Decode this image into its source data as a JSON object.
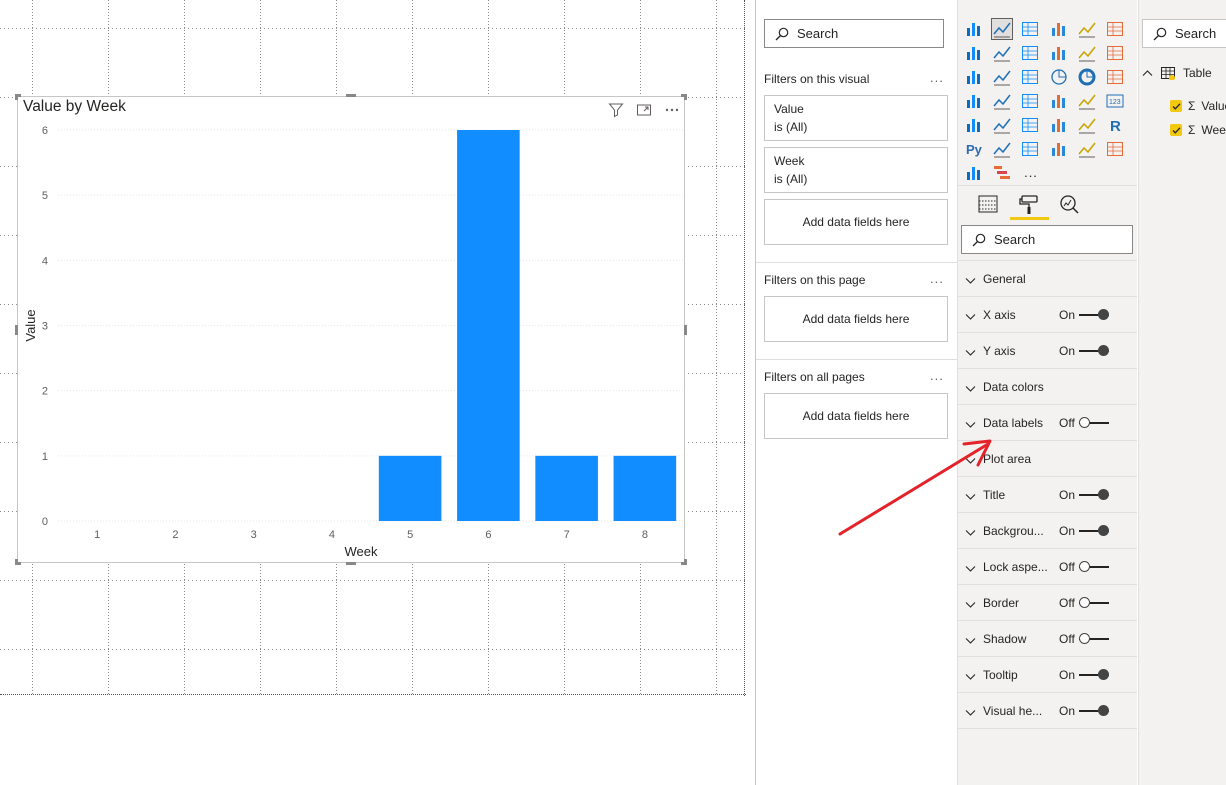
{
  "visual": {
    "title": "Value by Week"
  },
  "chart_data": {
    "type": "bar",
    "title": "Value by Week",
    "xlabel": "Week",
    "ylabel": "Value",
    "categories": [
      "1",
      "2",
      "3",
      "4",
      "5",
      "6",
      "7",
      "8"
    ],
    "values": [
      0,
      0,
      0,
      0,
      1,
      6,
      1,
      1
    ],
    "ylim": [
      0,
      6
    ],
    "yticks": [
      "0",
      "1",
      "2",
      "3",
      "4",
      "5",
      "6"
    ],
    "grid": true,
    "bar_color": "#118dff"
  },
  "filters_pane": {
    "search_placeholder": "Search",
    "on_visual_label": "Filters on this visual",
    "on_page_label": "Filters on this page",
    "on_all_pages_label": "Filters on all pages",
    "more": "...",
    "visual_filters": [
      {
        "name": "Value",
        "value": "is (All)"
      },
      {
        "name": "Week",
        "value": "is (All)"
      }
    ],
    "add_fields_label": "Add data fields here"
  },
  "viz_pane": {
    "search_placeholder": "Search",
    "more_visuals": "...",
    "tab_colors": {
      "accent": "#f2c811"
    },
    "format_rows": [
      {
        "label": "General",
        "state": "",
        "toggle": "none"
      },
      {
        "label": "X axis",
        "state": "On",
        "toggle": "on"
      },
      {
        "label": "Y axis",
        "state": "On",
        "toggle": "on"
      },
      {
        "label": "Data colors",
        "state": "",
        "toggle": "none"
      },
      {
        "label": "Data labels",
        "state": "Off",
        "toggle": "off"
      },
      {
        "label": "Plot area",
        "state": "",
        "toggle": "none"
      },
      {
        "label": "Title",
        "state": "On",
        "toggle": "on"
      },
      {
        "label": "Backgrou...",
        "state": "On",
        "toggle": "on"
      },
      {
        "label": "Lock aspe...",
        "state": "Off",
        "toggle": "off"
      },
      {
        "label": "Border",
        "state": "Off",
        "toggle": "off"
      },
      {
        "label": "Shadow",
        "state": "Off",
        "toggle": "off"
      },
      {
        "label": "Tooltip",
        "state": "On",
        "toggle": "on"
      },
      {
        "label": "Visual he...",
        "state": "On",
        "toggle": "on"
      }
    ]
  },
  "fields_pane": {
    "search_placeholder": "Search",
    "table_name": "Table",
    "fields": [
      {
        "name": "Value",
        "checked": true
      },
      {
        "name": "Week",
        "checked": true
      }
    ]
  }
}
